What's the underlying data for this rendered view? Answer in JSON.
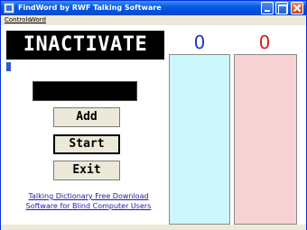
{
  "window": {
    "title": "FindWord by RWF  Talking Software"
  },
  "menu": {
    "items": [
      {
        "label": "Controls"
      },
      {
        "label": "Word"
      }
    ]
  },
  "game": {
    "word": "INACTIVATE",
    "score_left": "0",
    "score_right": "0",
    "input_value": ""
  },
  "buttons": {
    "add_label": "Add",
    "start_label": "Start",
    "exit_label": "Exit"
  },
  "links": {
    "line1": "Talking Dictionary Free Download",
    "line2": "Software for Blind Computer Users"
  },
  "colors": {
    "score_left": "#1e35c9",
    "score_right": "#d41f1f",
    "panel_left": "#ccf7fa",
    "panel_right": "#f7d2d5",
    "link": "#1a1aa8"
  },
  "icons": {
    "app": "app-icon",
    "minimize": "minimize-icon",
    "maximize": "maximize-icon",
    "close": "close-icon"
  }
}
